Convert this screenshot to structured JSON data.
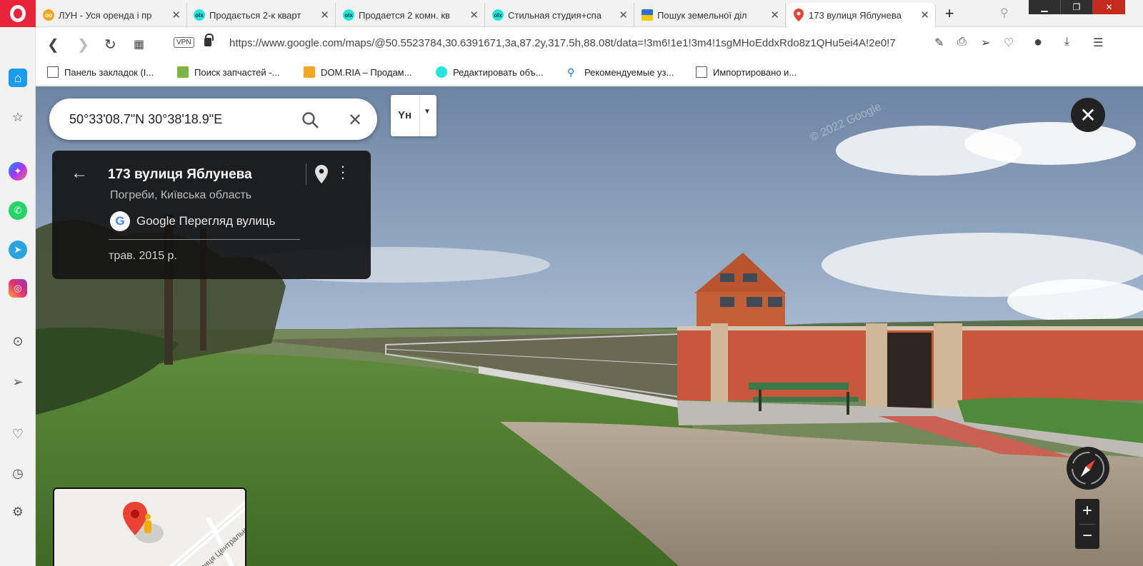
{
  "browser": {
    "tabs": [
      {
        "title": "ЛУН - Уся оренда і пр",
        "favicon": "owl-icon",
        "color": "#f5a623"
      },
      {
        "title": "Продається 2-к кварт",
        "favicon": "olx-icon",
        "color": "#23e5db"
      },
      {
        "title": "Продается 2 комн. кв",
        "favicon": "olx-icon",
        "color": "#23e5db"
      },
      {
        "title": "Стильная студия+спа",
        "favicon": "olx-icon",
        "color": "#23e5db"
      },
      {
        "title": "Пошук земельної діл",
        "favicon": "ukraine-emblem-icon",
        "color": "#f6c900"
      },
      {
        "title": "173 вулиця Яблунева",
        "favicon": "google-maps-pin-icon",
        "color": "#34a853",
        "active": true
      }
    ],
    "address": {
      "vpn_label": "VPN",
      "url": "https://www.google.com/maps/@50.5523784,30.6391671,3a,87.2y,317.5h,88.08t/data=!3m6!1e1!3m4!1sgMHoEddxRdo8z1QHu5ei4A!2e0!7"
    },
    "bookmarks": [
      {
        "label": "Панель закладок (I...",
        "icon": "folder-icon"
      },
      {
        "label": "Поиск запчастей -...",
        "icon": "search-bookmark-icon"
      },
      {
        "label": "DOM.RIA – Продам...",
        "icon": "domria-icon"
      },
      {
        "label": "Редактировать объ...",
        "icon": "olx-icon"
      },
      {
        "label": "Рекомендуемые уз...",
        "icon": "search-icon"
      },
      {
        "label": "Импортировано и...",
        "icon": "folder-icon"
      }
    ]
  },
  "maps": {
    "search": {
      "value": "50°33'08.7\"N 30°38'18.9\"E"
    },
    "language_toggle": "Yн",
    "card": {
      "title": "173 вулиця Яблунева",
      "subtitle": "Погреби, Київська область",
      "service": "Google Перегляд вулиць",
      "date": "трав. 2015 р."
    },
    "zoom_in": "+",
    "zoom_out": "−",
    "minimap_street": "вулиця Центральна",
    "watermark": "© 2022 Google"
  }
}
